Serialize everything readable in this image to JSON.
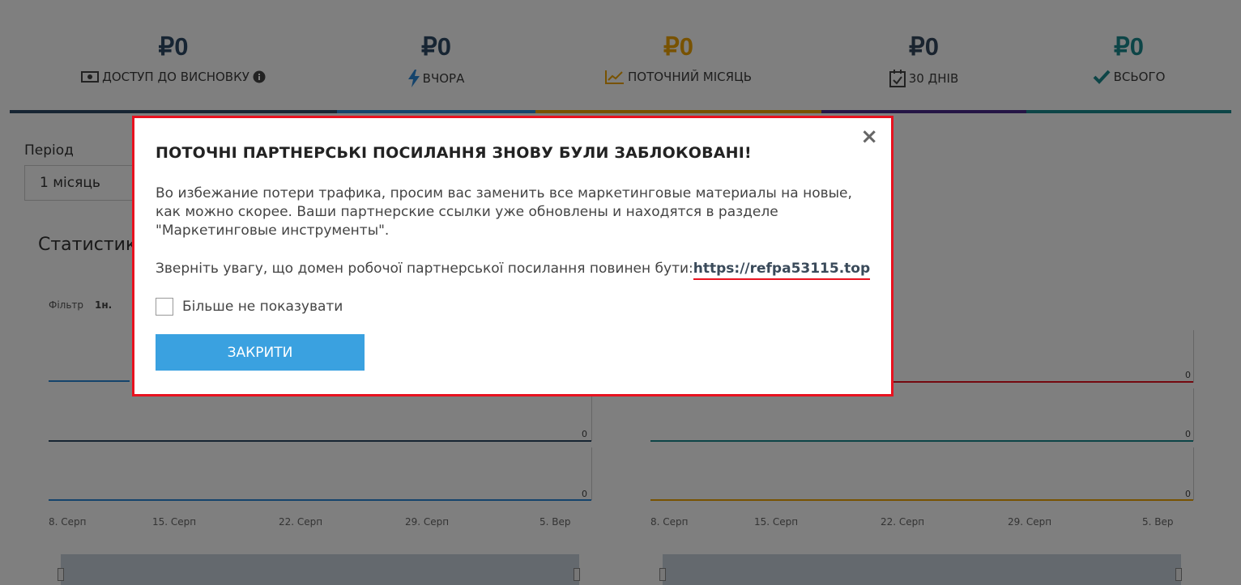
{
  "stats": [
    {
      "amount": "₽0",
      "label": "Доступ до висновку",
      "icon": "money-icon",
      "info_icon": "info-icon",
      "amount_color": "#2e4a66",
      "bar_color": "#2e4a66"
    },
    {
      "amount": "₽0",
      "label": "Вчора",
      "icon": "lightning-icon",
      "amount_color": "#2e4a66",
      "bar_color": "#2b88d8"
    },
    {
      "amount": "₽0",
      "label": "Поточний місяць",
      "icon": "trend-chart-icon",
      "amount_color": "#f0a500",
      "bar_color": "#f0a500"
    },
    {
      "amount": "₽0",
      "label": "30 днів",
      "icon": "calendar-check-icon",
      "amount_color": "#34495e",
      "bar_color": "#4a2a8a"
    },
    {
      "amount": "₽0",
      "label": "Всього",
      "icon": "checkmark-icon",
      "amount_color": "#1a8a8e",
      "bar_color": "#1a8a8e"
    }
  ],
  "period": {
    "label": "Період",
    "value": "1 місяць"
  },
  "section_title": "Статистика",
  "filter": {
    "label": "Фільтр",
    "option": "1н."
  },
  "charts": {
    "left": {
      "zero_labels": [
        "0",
        "0"
      ],
      "x_ticks": [
        "8. Серп",
        "15. Серп",
        "22. Серп",
        "29. Серп",
        "5. Вер"
      ]
    },
    "right": {
      "zero_labels": [
        "0",
        "0",
        "0"
      ],
      "x_ticks": [
        "8. Серп",
        "15. Серп",
        "22. Серп",
        "29. Серп",
        "5. Вер"
      ]
    }
  },
  "modal": {
    "close_label": "×",
    "title": "ПОТОЧНІ ПАРТНЕРСЬКІ ПОСИЛАННЯ ЗНОВУ БУЛИ ЗАБЛОКОВАНІ!",
    "message": "Во избежание потери трафика, просим вас заменить все маркетинговые материалы на новые, как можно скорее. Ваши партнерские ссылки уже обновлены и находятся в разделе \"Маркетинговые инструменты\".",
    "domain_prefix": "Зверніть увагу, що домен робочої партнерської посилання повинен бути:",
    "domain_link": "https://refpa53115.top",
    "checkbox_label": "Більше не показувати",
    "button_label": "ЗАКРИТИ"
  },
  "colors": {
    "accent_button": "#3aa1e0",
    "modal_border": "#e8121f",
    "overlay": "rgba(0,0,0,0.5)"
  }
}
